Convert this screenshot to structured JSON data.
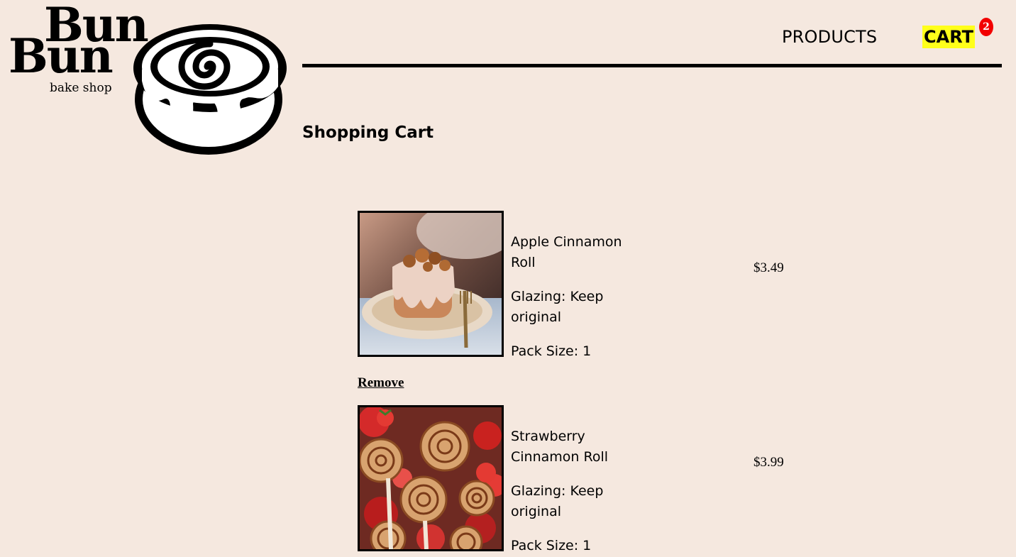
{
  "brand": {
    "word1": "Bun",
    "word2": "Bun",
    "subtitle": "bake shop",
    "logo_icon": "cinnamon-bun-icon"
  },
  "nav": {
    "products_label": "PRODUCTS",
    "cart_label": "CART",
    "cart_count": "2",
    "cart_highlight_color": "#ffff1a",
    "badge_color": "#f20000"
  },
  "page": {
    "title": "Shopping Cart",
    "background": "#f5e8df"
  },
  "cart": {
    "items": [
      {
        "name": "Apple Cinnamon Roll",
        "glazing": "Glazing: Keep original",
        "pack_size": "Pack Size: 1",
        "price": "$3.49",
        "remove_label": "Remove",
        "image": "apple-cinnamon-roll-photo"
      },
      {
        "name": "Strawberry Cinnamon Roll",
        "glazing": "Glazing: Keep original",
        "pack_size": "Pack Size: 1",
        "price": "$3.99",
        "image": "strawberry-cinnamon-roll-photo"
      }
    ]
  }
}
